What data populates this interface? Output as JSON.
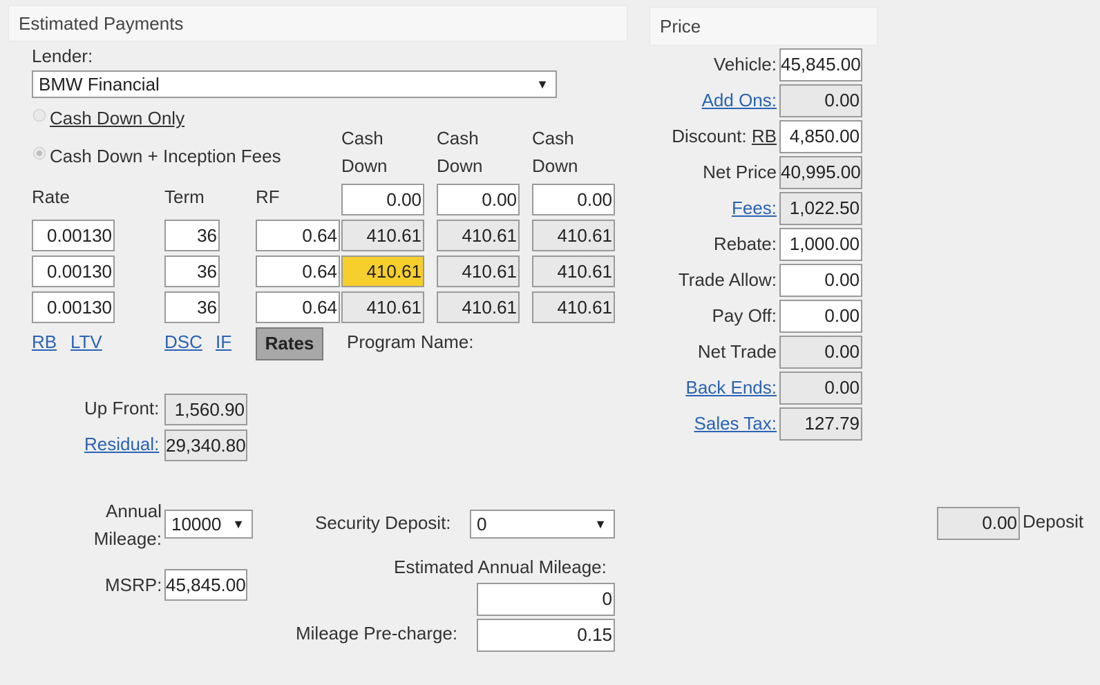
{
  "estimated_payments": {
    "title": "Estimated Payments",
    "lender_label": "Lender:",
    "lender_value": "BMW Financial",
    "radio_cash_down_only": "Cash Down Only",
    "radio_cash_down_inception": "Cash Down + Inception Fees",
    "col_headers": [
      "Cash\nDown",
      "Cash\nDown",
      "Cash\nDown"
    ],
    "rate_header": "Rate",
    "term_header": "Term",
    "rf_header": "RF",
    "cash_down_values": [
      "0.00",
      "0.00",
      "0.00"
    ],
    "rows": [
      {
        "rate": "0.00130",
        "term": "36",
        "rf": "0.64",
        "payments": [
          "410.61",
          "410.61",
          "410.61"
        ]
      },
      {
        "rate": "0.00130",
        "term": "36",
        "rf": "0.64",
        "payments": [
          "410.61",
          "410.61",
          "410.61"
        ]
      },
      {
        "rate": "0.00130",
        "term": "36",
        "rf": "0.64",
        "payments": [
          "410.61",
          "410.61",
          "410.61"
        ]
      }
    ],
    "link_rb": "RB",
    "link_ltv": "LTV",
    "link_dsc": "DSC",
    "link_if": "IF",
    "rates_button": "Rates",
    "program_name_label": "Program Name:",
    "up_front_label": "Up Front:",
    "up_front_value": "1,560.90",
    "residual_label": "Residual:",
    "residual_value": "29,340.80",
    "annual_mileage_label_1": "Annual",
    "annual_mileage_label_2": "Mileage:",
    "annual_mileage_value": "10000",
    "security_deposit_label": "Security Deposit:",
    "security_deposit_value": "0",
    "msrp_label": "MSRP:",
    "msrp_value": "45,845.00",
    "est_annual_mileage_label": "Estimated Annual Mileage:",
    "est_annual_mileage_value": "0",
    "mileage_precharge_label": "Mileage Pre-charge:",
    "mileage_precharge_value": "0.15",
    "deposit_value": "0.00",
    "deposit_label": "Deposit"
  },
  "price": {
    "title": "Price",
    "vehicle_label": "Vehicle:",
    "vehicle_value": "45,845.00",
    "add_ons_label": "Add Ons:",
    "add_ons_value": "0.00",
    "discount_label": "Discount:",
    "discount_rb": "RB",
    "discount_value": "4,850.00",
    "net_price_label": "Net Price",
    "net_price_value": "40,995.00",
    "fees_label": "Fees:",
    "fees_value": "1,022.50",
    "rebate_label": "Rebate:",
    "rebate_value": "1,000.00",
    "trade_allow_label": "Trade Allow:",
    "trade_allow_value": "0.00",
    "pay_off_label": "Pay Off:",
    "pay_off_value": "0.00",
    "net_trade_label": "Net Trade",
    "net_trade_value": "0.00",
    "back_ends_label": "Back Ends:",
    "back_ends_value": "0.00",
    "sales_tax_label": "Sales Tax:",
    "sales_tax_value": "127.79"
  }
}
